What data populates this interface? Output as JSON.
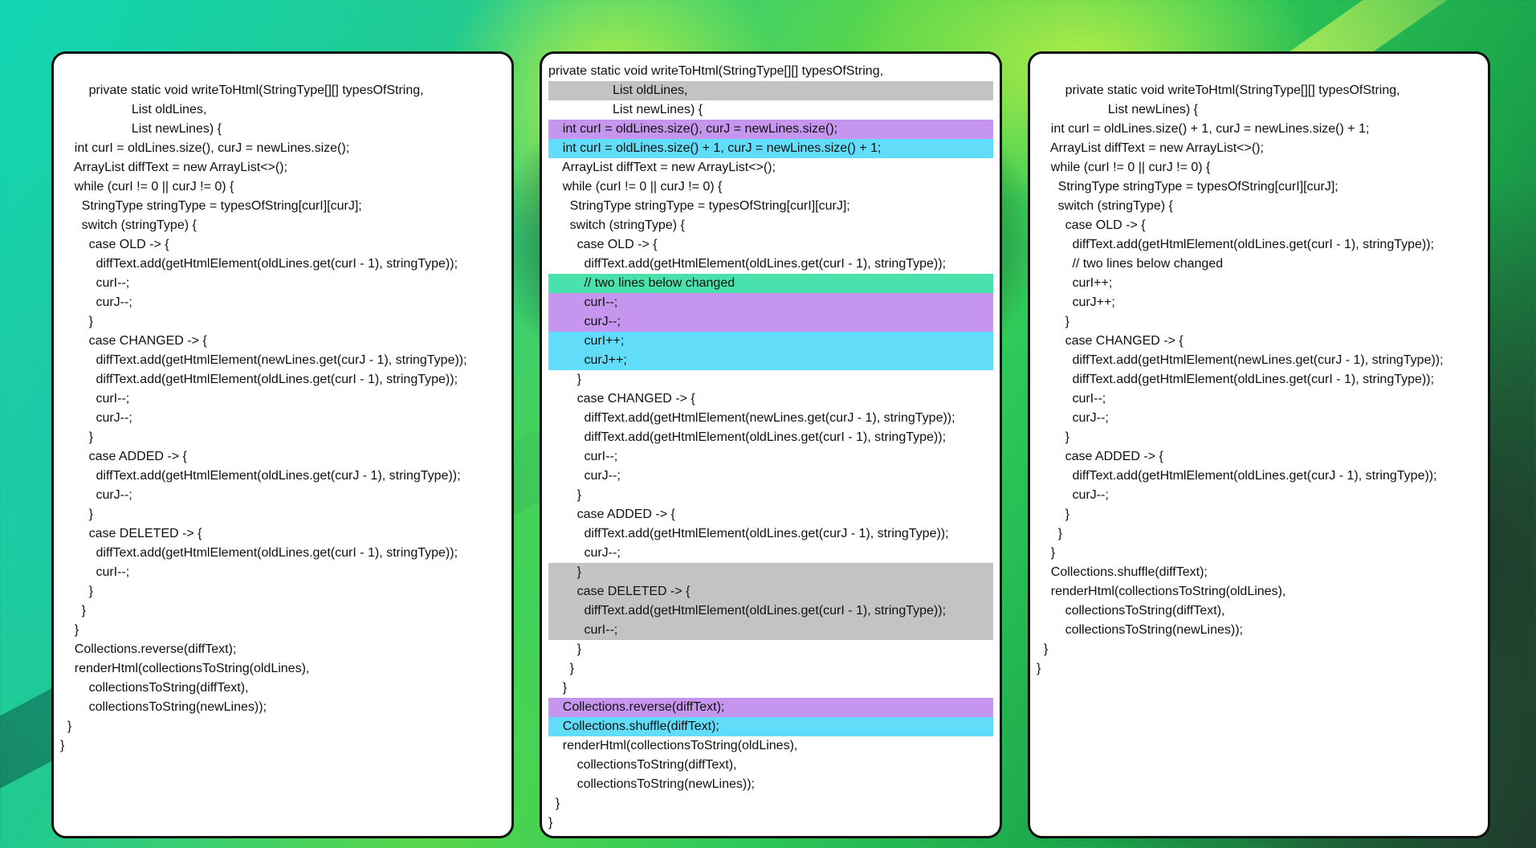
{
  "panels": [
    {
      "id": "left",
      "lines": [
        {
          "text": "        private static void writeToHtml(StringType[][] typesOfString,",
          "hl": ""
        },
        {
          "text": "                    List oldLines,",
          "hl": ""
        },
        {
          "text": "                    List newLines) {",
          "hl": ""
        },
        {
          "text": "    int curI = oldLines.size(), curJ = newLines.size();",
          "hl": ""
        },
        {
          "text": "    ArrayList diffText = new ArrayList<>();",
          "hl": ""
        },
        {
          "text": "    while (curI != 0 || curJ != 0) {",
          "hl": ""
        },
        {
          "text": "      StringType stringType = typesOfString[curI][curJ];",
          "hl": ""
        },
        {
          "text": "      switch (stringType) {",
          "hl": ""
        },
        {
          "text": "        case OLD -> {",
          "hl": ""
        },
        {
          "text": "          diffText.add(getHtmlElement(oldLines.get(curI - 1), stringType));",
          "hl": ""
        },
        {
          "text": "          curI--;",
          "hl": ""
        },
        {
          "text": "          curJ--;",
          "hl": ""
        },
        {
          "text": "        }",
          "hl": ""
        },
        {
          "text": "        case CHANGED -> {",
          "hl": ""
        },
        {
          "text": "          diffText.add(getHtmlElement(newLines.get(curJ - 1), stringType));",
          "hl": ""
        },
        {
          "text": "          diffText.add(getHtmlElement(oldLines.get(curI - 1), stringType));",
          "hl": ""
        },
        {
          "text": "          curI--;",
          "hl": ""
        },
        {
          "text": "          curJ--;",
          "hl": ""
        },
        {
          "text": "        }",
          "hl": ""
        },
        {
          "text": "        case ADDED -> {",
          "hl": ""
        },
        {
          "text": "          diffText.add(getHtmlElement(oldLines.get(curJ - 1), stringType));",
          "hl": ""
        },
        {
          "text": "          curJ--;",
          "hl": ""
        },
        {
          "text": "        }",
          "hl": ""
        },
        {
          "text": "        case DELETED -> {",
          "hl": ""
        },
        {
          "text": "          diffText.add(getHtmlElement(oldLines.get(curI - 1), stringType));",
          "hl": ""
        },
        {
          "text": "          curI--;",
          "hl": ""
        },
        {
          "text": "        }",
          "hl": ""
        },
        {
          "text": "      }",
          "hl": ""
        },
        {
          "text": "    }",
          "hl": ""
        },
        {
          "text": "    Collections.reverse(diffText);",
          "hl": ""
        },
        {
          "text": "    renderHtml(collectionsToString(oldLines),",
          "hl": ""
        },
        {
          "text": "        collectionsToString(diffText),",
          "hl": ""
        },
        {
          "text": "        collectionsToString(newLines));",
          "hl": ""
        },
        {
          "text": "  }",
          "hl": ""
        },
        {
          "text": "}",
          "hl": ""
        }
      ]
    },
    {
      "id": "mid",
      "lines": [
        {
          "text": "private static void writeToHtml(StringType[][] typesOfString,",
          "hl": ""
        },
        {
          "text": "                  List oldLines,",
          "hl": "gray"
        },
        {
          "text": "                  List newLines) {",
          "hl": ""
        },
        {
          "text": "    int curI = oldLines.size(), curJ = newLines.size();",
          "hl": "purple"
        },
        {
          "text": "    int curI = oldLines.size() + 1, curJ = newLines.size() + 1;",
          "hl": "cyan"
        },
        {
          "text": "    ArrayList diffText = new ArrayList<>();",
          "hl": ""
        },
        {
          "text": "    while (curI != 0 || curJ != 0) {",
          "hl": ""
        },
        {
          "text": "      StringType stringType = typesOfString[curI][curJ];",
          "hl": ""
        },
        {
          "text": "      switch (stringType) {",
          "hl": ""
        },
        {
          "text": "        case OLD -> {",
          "hl": ""
        },
        {
          "text": "          diffText.add(getHtmlElement(oldLines.get(curI - 1), stringType));",
          "hl": ""
        },
        {
          "text": "          // two lines below changed",
          "hl": "green"
        },
        {
          "text": "          curI--;",
          "hl": "purple"
        },
        {
          "text": "          curJ--;",
          "hl": "purple"
        },
        {
          "text": "          curI++;",
          "hl": "cyan"
        },
        {
          "text": "          curJ++;",
          "hl": "cyan"
        },
        {
          "text": "        }",
          "hl": ""
        },
        {
          "text": "        case CHANGED -> {",
          "hl": ""
        },
        {
          "text": "          diffText.add(getHtmlElement(newLines.get(curJ - 1), stringType));",
          "hl": ""
        },
        {
          "text": "          diffText.add(getHtmlElement(oldLines.get(curI - 1), stringType));",
          "hl": ""
        },
        {
          "text": "          curI--;",
          "hl": ""
        },
        {
          "text": "          curJ--;",
          "hl": ""
        },
        {
          "text": "        }",
          "hl": ""
        },
        {
          "text": "        case ADDED -> {",
          "hl": ""
        },
        {
          "text": "          diffText.add(getHtmlElement(oldLines.get(curJ - 1), stringType));",
          "hl": ""
        },
        {
          "text": "          curJ--;",
          "hl": ""
        },
        {
          "text": "        }",
          "hl": "gray"
        },
        {
          "text": "        case DELETED -> {",
          "hl": "gray"
        },
        {
          "text": "          diffText.add(getHtmlElement(oldLines.get(curI - 1), stringType));",
          "hl": "gray"
        },
        {
          "text": "          curI--;",
          "hl": "gray"
        },
        {
          "text": "        }",
          "hl": ""
        },
        {
          "text": "      }",
          "hl": ""
        },
        {
          "text": "    }",
          "hl": ""
        },
        {
          "text": "    Collections.reverse(diffText);",
          "hl": "purple"
        },
        {
          "text": "    Collections.shuffle(diffText);",
          "hl": "cyan"
        },
        {
          "text": "    renderHtml(collectionsToString(oldLines),",
          "hl": ""
        },
        {
          "text": "        collectionsToString(diffText),",
          "hl": ""
        },
        {
          "text": "        collectionsToString(newLines));",
          "hl": ""
        },
        {
          "text": "  }",
          "hl": ""
        },
        {
          "text": "}",
          "hl": ""
        }
      ]
    },
    {
      "id": "right",
      "lines": [
        {
          "text": "        private static void writeToHtml(StringType[][] typesOfString,",
          "hl": ""
        },
        {
          "text": "                    List newLines) {",
          "hl": ""
        },
        {
          "text": "    int curI = oldLines.size() + 1, curJ = newLines.size() + 1;",
          "hl": ""
        },
        {
          "text": "    ArrayList diffText = new ArrayList<>();",
          "hl": ""
        },
        {
          "text": "    while (curI != 0 || curJ != 0) {",
          "hl": ""
        },
        {
          "text": "      StringType stringType = typesOfString[curI][curJ];",
          "hl": ""
        },
        {
          "text": "      switch (stringType) {",
          "hl": ""
        },
        {
          "text": "        case OLD -> {",
          "hl": ""
        },
        {
          "text": "          diffText.add(getHtmlElement(oldLines.get(curI - 1), stringType));",
          "hl": ""
        },
        {
          "text": "          // two lines below changed",
          "hl": ""
        },
        {
          "text": "          curI++;",
          "hl": ""
        },
        {
          "text": "          curJ++;",
          "hl": ""
        },
        {
          "text": "        }",
          "hl": ""
        },
        {
          "text": "        case CHANGED -> {",
          "hl": ""
        },
        {
          "text": "          diffText.add(getHtmlElement(newLines.get(curJ - 1), stringType));",
          "hl": ""
        },
        {
          "text": "          diffText.add(getHtmlElement(oldLines.get(curI - 1), stringType));",
          "hl": ""
        },
        {
          "text": "          curI--;",
          "hl": ""
        },
        {
          "text": "          curJ--;",
          "hl": ""
        },
        {
          "text": "        }",
          "hl": ""
        },
        {
          "text": "        case ADDED -> {",
          "hl": ""
        },
        {
          "text": "          diffText.add(getHtmlElement(oldLines.get(curJ - 1), stringType));",
          "hl": ""
        },
        {
          "text": "          curJ--;",
          "hl": ""
        },
        {
          "text": "        }",
          "hl": ""
        },
        {
          "text": "      }",
          "hl": ""
        },
        {
          "text": "    }",
          "hl": ""
        },
        {
          "text": "    Collections.shuffle(diffText);",
          "hl": ""
        },
        {
          "text": "    renderHtml(collectionsToString(oldLines),",
          "hl": ""
        },
        {
          "text": "        collectionsToString(diffText),",
          "hl": ""
        },
        {
          "text": "        collectionsToString(newLines));",
          "hl": ""
        },
        {
          "text": "  }",
          "hl": ""
        },
        {
          "text": "}",
          "hl": ""
        }
      ]
    }
  ],
  "highlight_colors": {
    "gray": "#c3c3c3",
    "purple": "#c695ee",
    "cyan": "#62ddf9",
    "green": "#49e2ac"
  }
}
